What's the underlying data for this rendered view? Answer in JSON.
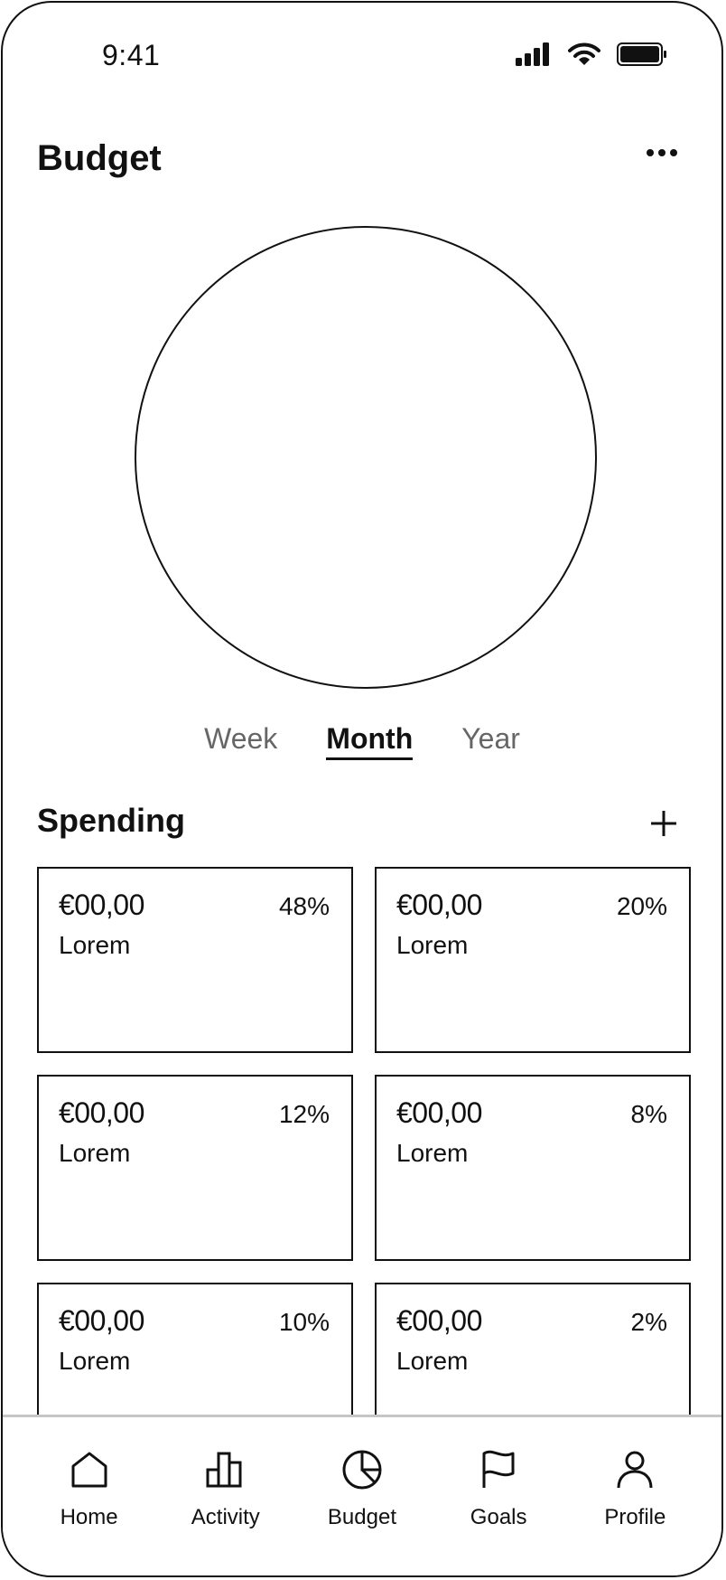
{
  "status": {
    "time": "9:41",
    "icons": [
      "cellular-signal-icon",
      "wifi-icon",
      "battery-icon"
    ]
  },
  "header": {
    "title": "Budget",
    "more_icon": "more-horizontal-icon"
  },
  "period_tabs": {
    "items": [
      {
        "label": "Week",
        "active": false
      },
      {
        "label": "Month",
        "active": true
      },
      {
        "label": "Year",
        "active": false
      }
    ]
  },
  "spending": {
    "title": "Spending",
    "add_icon": "plus-icon",
    "cards": [
      {
        "amount": "€00,00",
        "label": "Lorem",
        "percent": "48%"
      },
      {
        "amount": "€00,00",
        "label": "Lorem",
        "percent": "20%"
      },
      {
        "amount": "€00,00",
        "label": "Lorem",
        "percent": "12%"
      },
      {
        "amount": "€00,00",
        "label": "Lorem",
        "percent": "8%"
      },
      {
        "amount": "€00,00",
        "label": "Lorem",
        "percent": "10%"
      },
      {
        "amount": "€00,00",
        "label": "Lorem",
        "percent": "2%"
      }
    ]
  },
  "tabbar": {
    "items": [
      {
        "label": "Home",
        "icon": "home-icon"
      },
      {
        "label": "Activity",
        "icon": "bar-chart-icon"
      },
      {
        "label": "Budget",
        "icon": "pie-chart-icon"
      },
      {
        "label": "Goals",
        "icon": "flag-icon"
      },
      {
        "label": "Profile",
        "icon": "user-icon"
      }
    ]
  },
  "colors": {
    "ink": "#111111",
    "muted": "#666666",
    "divider": "#c6c6c6"
  }
}
